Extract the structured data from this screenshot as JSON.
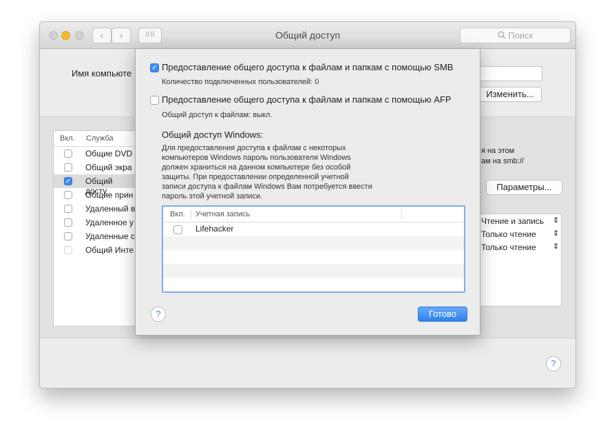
{
  "window": {
    "title": "Общий доступ",
    "search_placeholder": "Поиск",
    "nav_back": "‹",
    "nav_forward": "›",
    "grid_glyph": "⠿⠿"
  },
  "background": {
    "computer_name_label": "Имя компьюте",
    "change_button": "Изменить...",
    "info_line1": "я на этом",
    "info_line2": "ам на smb://",
    "params_button": "Параметры...",
    "services_header_on": "Вкл.",
    "services_header_service": "Служба",
    "services": [
      {
        "label": "Общие DVD",
        "checked": false
      },
      {
        "label": "Общий экра",
        "checked": false
      },
      {
        "label": "Общий досту",
        "checked": true
      },
      {
        "label": "Общие прин",
        "checked": false
      },
      {
        "label": "Удаленный в",
        "checked": false
      },
      {
        "label": "Удаленное у",
        "checked": false
      },
      {
        "label": "Удаленные с",
        "checked": false
      },
      {
        "label": "Общий Инте",
        "checked": false
      }
    ],
    "permissions": [
      "Чтение и запись",
      "Только чтение",
      "Только чтение"
    ],
    "updown_glyph": "⇕",
    "help": "?"
  },
  "sheet": {
    "smb_label": "Предоставление общего доступа к файлам и папкам с помощью SMB",
    "smb_checked": true,
    "smb_users": "Количество подключенных пользователей: 0",
    "afp_label": "Предоставление общего доступа к файлам и папкам с помощью AFP",
    "afp_checked": false,
    "afp_status": "Общий доступ к файлам: выкл.",
    "windows_title": "Общий доступ Windows:",
    "windows_desc": [
      "Для предоставления доступа к файлам с некоторых",
      "компьютеров Windows пароль пользователя Windows",
      "должен храниться на данном компьютере без особой",
      "защиты. При предоставлении определенной учетной",
      "записи доступа к файлам Windows Вам потребуется ввести",
      "пароль этой учетной записи."
    ],
    "table_header_on": "Вкл.",
    "table_header_account": "Учетная запись",
    "accounts": [
      {
        "name": "Lifehacker",
        "checked": false
      }
    ],
    "help": "?",
    "done_button": "Готово",
    "check_glyph": "✓"
  }
}
